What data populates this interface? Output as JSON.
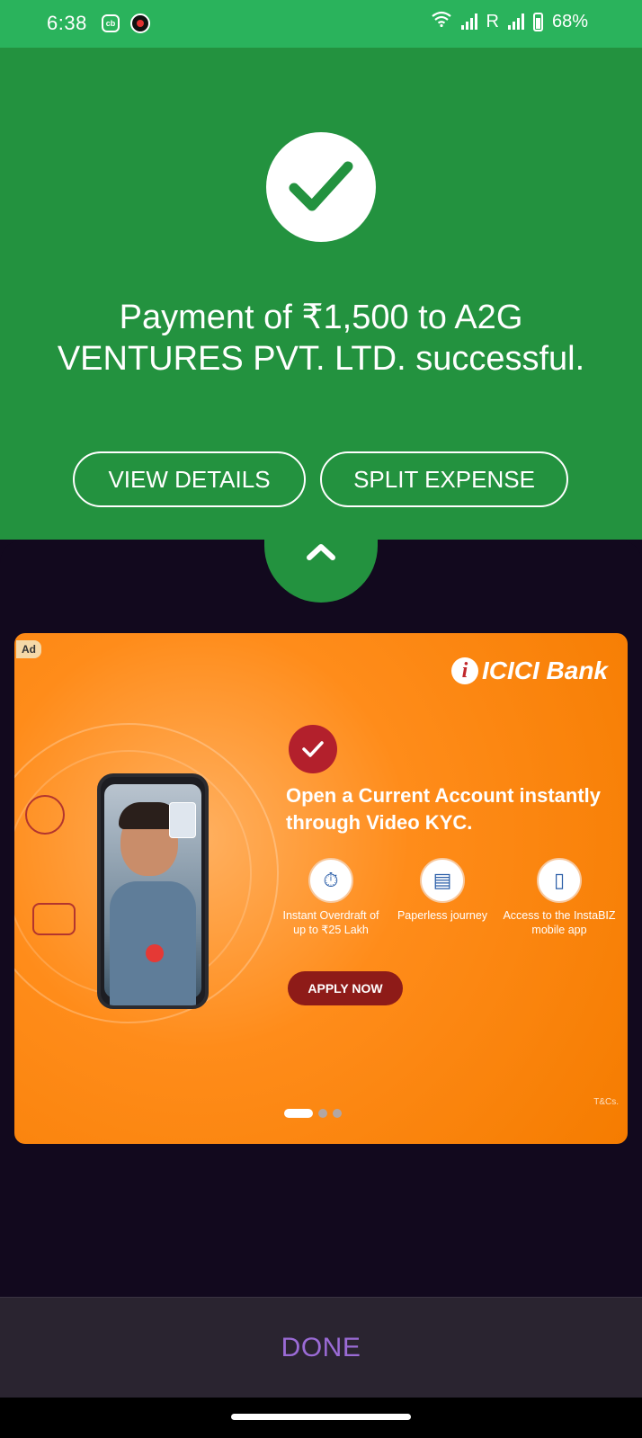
{
  "status_bar": {
    "time": "6:38",
    "app_badge": "cb",
    "roaming_indicator": "R",
    "battery": "68%"
  },
  "payment": {
    "message": "Payment of ₹1,500 to A2G VENTURES PVT. LTD. successful.",
    "view_details_label": "VIEW DETAILS",
    "split_expense_label": "SPLIT EXPENSE"
  },
  "ad": {
    "badge": "Ad",
    "bank_name": "ICICI Bank",
    "bank_mark": "i",
    "headline": "Open a Current Account instantly through Video KYC.",
    "features": [
      {
        "icon": "stopwatch-icon",
        "label": "Instant Overdraft of up to ₹25 Lakh"
      },
      {
        "icon": "document-icon",
        "label": "Paperless journey"
      },
      {
        "icon": "mobile-app-icon",
        "label": "Access to the InstaBIZ mobile app"
      }
    ],
    "cta_label": "APPLY NOW",
    "terms": "T&Cs.",
    "carousel": {
      "count": 3,
      "active_index": 0
    }
  },
  "footer": {
    "done_label": "DONE"
  },
  "colors": {
    "success_green": "#23923f",
    "status_green": "#2ab35c",
    "panel_dark": "#12091e",
    "done_purple": "#9b6bd6",
    "ad_orange": "#f57c00"
  }
}
